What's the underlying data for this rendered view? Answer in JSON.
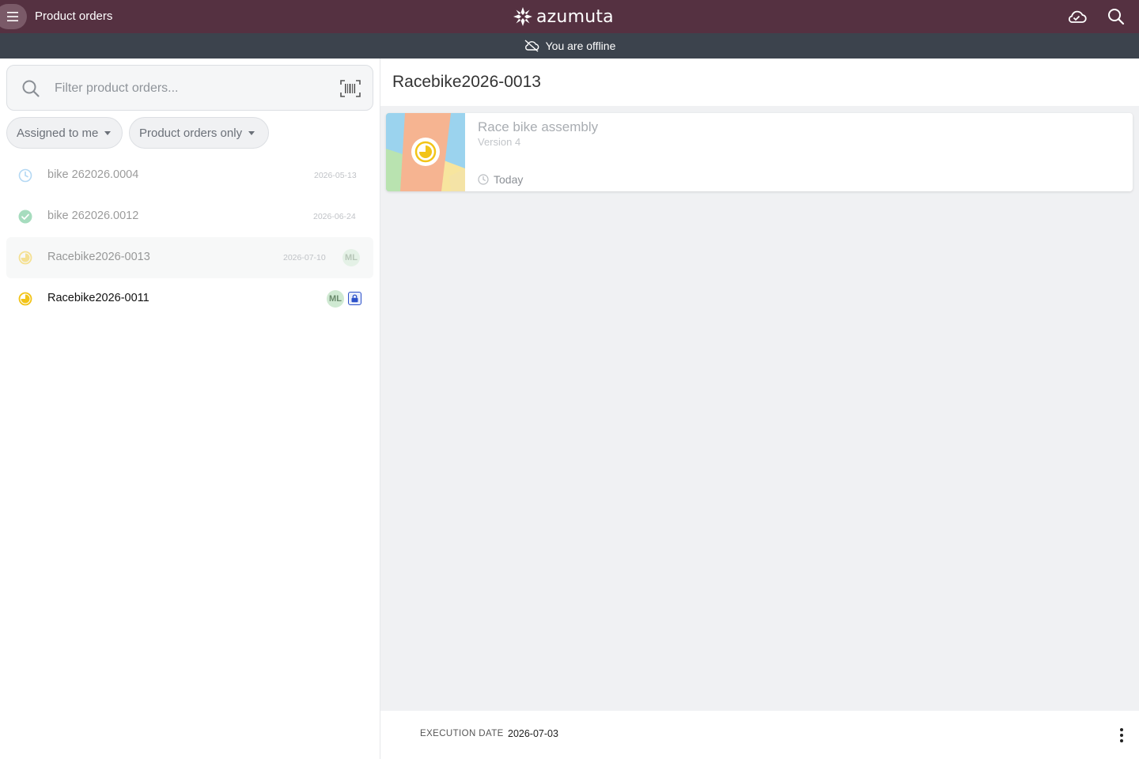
{
  "header": {
    "title": "Product orders",
    "logo_text": "azumuta",
    "bar_color": "#553141"
  },
  "offline_banner": {
    "text": "You are offline"
  },
  "search": {
    "placeholder": "Filter product orders..."
  },
  "filters": [
    {
      "label": "Assigned to me"
    },
    {
      "label": "Product orders only"
    }
  ],
  "orders": [
    {
      "name": "bike 262026.0004",
      "date": "2026-05-13",
      "status": "scheduled",
      "status_icon": "clock-icon",
      "faded": true
    },
    {
      "name": "bike 262026.0012",
      "date": "2026-06-24",
      "status": "done",
      "status_icon": "check-circle-icon",
      "faded": true
    },
    {
      "name": "Racebike2026-0013",
      "date": "2026-07-10",
      "assignee": "ML",
      "status": "in-progress",
      "status_icon": "progress-icon",
      "faded": true,
      "selected": true
    },
    {
      "name": "Racebike2026-0011",
      "date": "",
      "assignee": "ML",
      "status": "in-progress",
      "status_icon": "progress-icon",
      "faded": false,
      "locked": true
    }
  ],
  "detail": {
    "title": "Racebike2026-0013",
    "card": {
      "title": "Race bike assembly",
      "version": "Version 4",
      "time": "Today"
    },
    "footer": {
      "execution_date_label": "EXECUTION DATE",
      "execution_date_value": "2026-07-03"
    }
  },
  "colors": {
    "progress_yellow": "#f2c418",
    "done_green": "#3cb371",
    "scheduled_blue": "#5aa9e6",
    "lock_blue": "#2b50c9"
  }
}
